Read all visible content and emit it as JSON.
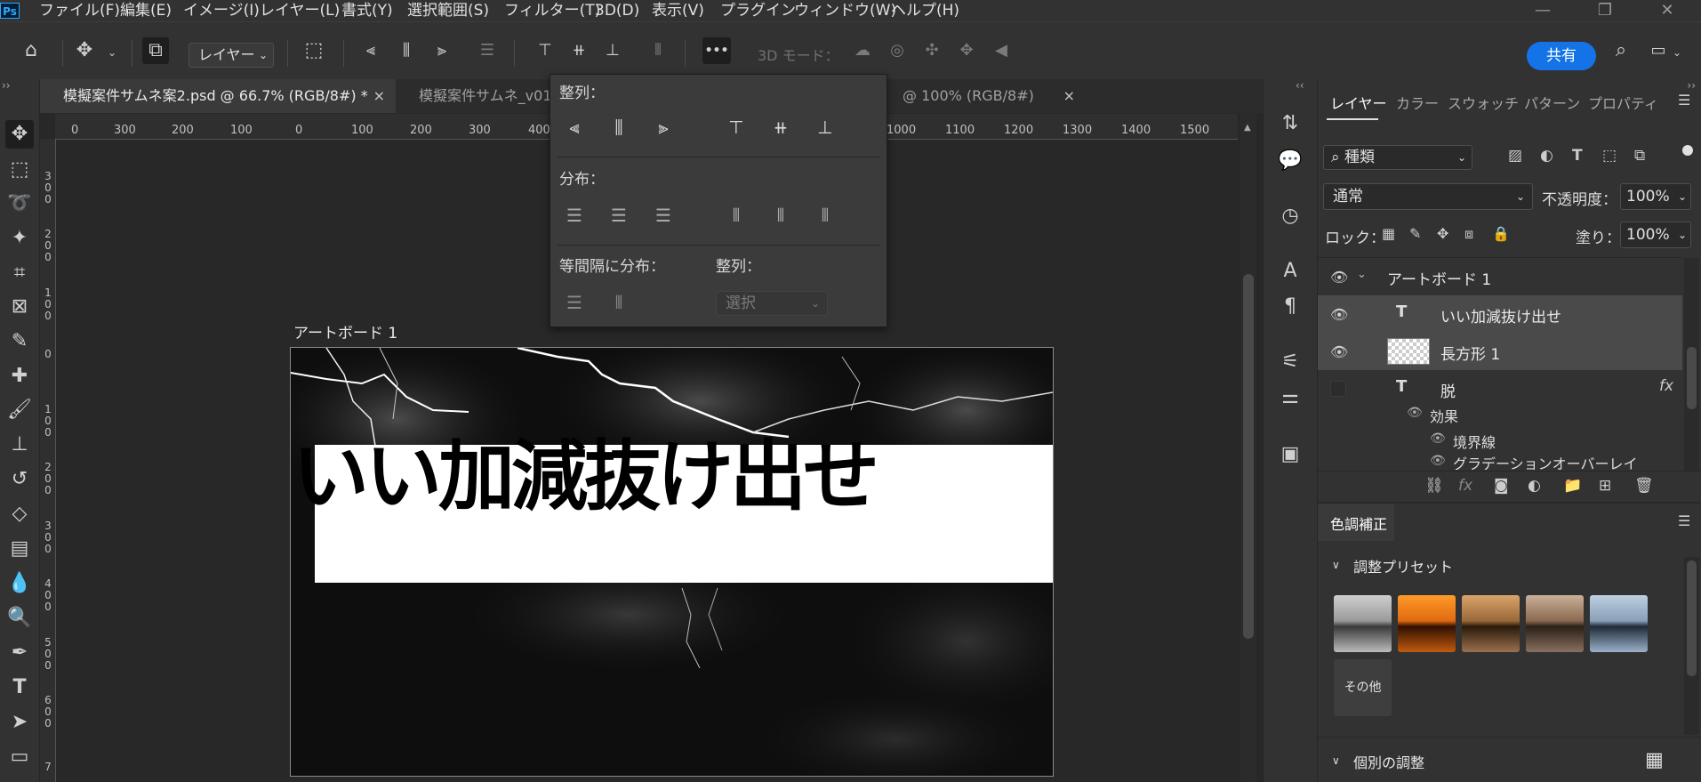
{
  "app": {
    "logo": "Ps"
  },
  "menu": [
    "ファイル(F)",
    "編集(E)",
    "イメージ(I)",
    "レイヤー(L)",
    "書式(Y)",
    "選択範囲(S)",
    "フィルター(T)",
    "3D(D)",
    "表示(V)",
    "プラグイン",
    "ウィンドウ(W)",
    "ヘルプ(H)"
  ],
  "window_controls": {
    "minimize": "—",
    "restore": "❐",
    "close": "✕"
  },
  "options_bar": {
    "layer_select": "レイヤー",
    "mode_3d": "3D モード：",
    "share_button": "共有",
    "more": "•••"
  },
  "tabs": [
    {
      "title": "模擬案件サムネ案2.psd @ 66.7% (RGB/8#) *",
      "close": "×"
    },
    {
      "title": "模擬案件サムネ_v01",
      "close": ""
    },
    {
      "title": "@ 100% (RGB/8#)",
      "close": "×"
    }
  ],
  "ruler": {
    "h": [
      "0",
      "300",
      "200",
      "100",
      "0",
      "100",
      "200",
      "300",
      "400",
      "1000",
      "1100",
      "1200",
      "1300",
      "1400",
      "1500"
    ],
    "v": [
      "3\n0\n0",
      "2\n0\n0",
      "1\n0\n0",
      "0",
      "1\n0\n0",
      "2\n0\n0",
      "3\n0\n0",
      "4\n0\n0",
      "5\n0\n0",
      "6\n0\n0",
      "7"
    ]
  },
  "artboard": {
    "label": "アートボード 1",
    "headline": "いい加減抜け出せ"
  },
  "align_popup": {
    "align_label": "整列：",
    "distribute_label": "分布：",
    "equal_spacing_label": "等間隔に分布：",
    "align_to_label": "整列：",
    "align_to_value": "選択"
  },
  "layers_panel": {
    "tabs": [
      "レイヤー",
      "カラー",
      "スウォッチ",
      "パターン",
      "プロパティ"
    ],
    "filter_kind": "種類",
    "blend_mode": "通常",
    "opacity_label": "不透明度：",
    "opacity_value": "100%",
    "lock_label": "ロック：",
    "fill_label": "塗り：",
    "fill_value": "100%",
    "layers": [
      {
        "name": "アートボード 1",
        "type": "artboard"
      },
      {
        "name": "いい加減抜け出せ",
        "type": "text"
      },
      {
        "name": "長方形 1",
        "type": "shape"
      },
      {
        "name": "脱",
        "type": "text",
        "fx": "fx"
      },
      {
        "name": "効果",
        "type": "effects"
      },
      {
        "name": "境界線",
        "type": "effect"
      },
      {
        "name": "グラデーションオーバーレイ",
        "type": "effect"
      }
    ]
  },
  "adjustments_panel": {
    "title": "色調補正",
    "presets_label": "調整プリセット",
    "other_label": "その他",
    "individual_label": "個別の調整"
  },
  "colors": {
    "accent_blue": "#1473e6",
    "panel_bg": "#323232",
    "canvas_bg": "#282828",
    "selected_row": "#4a4a4a"
  }
}
